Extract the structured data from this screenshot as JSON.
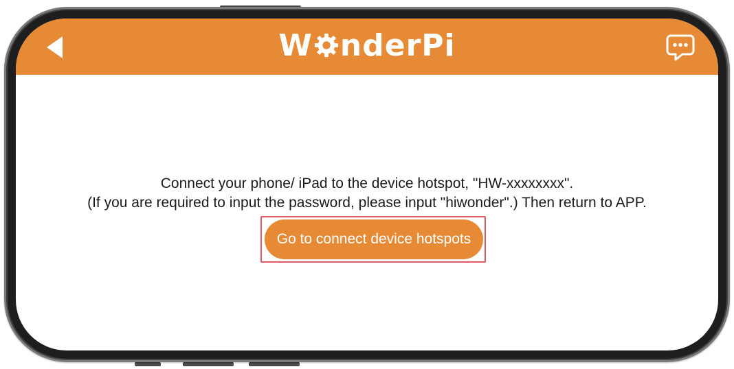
{
  "header": {
    "logo_text": "WonderPi",
    "back_icon": "back-arrow-icon",
    "chat_icon": "chat-bubble-icon"
  },
  "main": {
    "message_line1": "Connect your phone/ iPad to the device hotspot, \"HW-xxxxxxxx\".",
    "message_line2": "(If you are required to input the password, please input \"hiwonder\".) Then return to APP.",
    "connect_button_label": "Go to connect device hotspots"
  },
  "colors": {
    "accent": "#e68a36",
    "highlight_outline": "#e05a66",
    "text": "#1a1a1a",
    "device_frame": "#1e1e1e"
  }
}
